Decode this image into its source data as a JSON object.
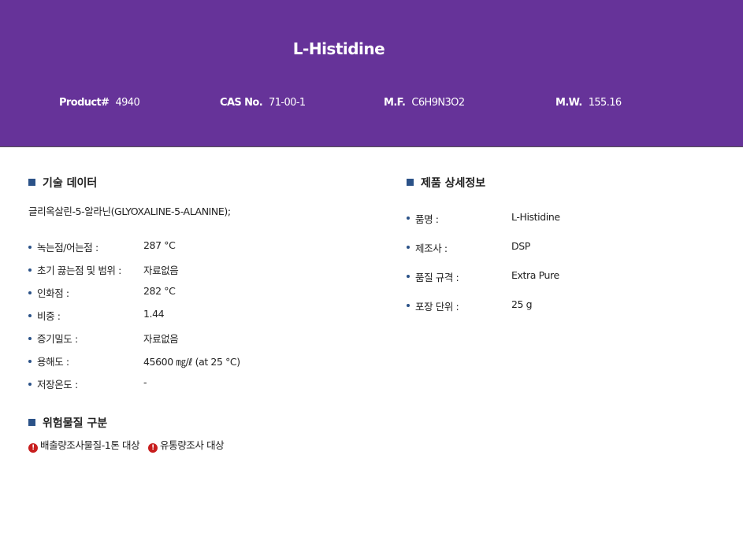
{
  "header": {
    "title": "L-Histidine",
    "product_label": "Product#",
    "product_value": "4940",
    "cas_label": "CAS No.",
    "cas_value": "71-00-1",
    "mf_label": "M.F.",
    "mf_value": "C6H9N3O2",
    "mw_label": "M.W.",
    "mw_value": "155.16",
    "background_color": "#663399"
  },
  "tech_data": {
    "heading": "기술 데이터",
    "synonym": "글리옥살린-5-알라닌(GLYOXALINE-5-ALANINE);",
    "properties": [
      {
        "label": "녹는점/어는점 :",
        "value": "287 °C"
      },
      {
        "label": "초기 끓는점 및 범위 :",
        "value": "자료없음"
      },
      {
        "label": "인화점 :",
        "value": "282 °C"
      },
      {
        "label": "비중 :",
        "value": "1.44"
      },
      {
        "label": "증기밀도 :",
        "value": "자료없음"
      },
      {
        "label": "용해도 :",
        "value": "45600 ㎎/ℓ (at 25 °C)"
      },
      {
        "label": "저장온도 :",
        "value": "-"
      }
    ]
  },
  "product_details": {
    "heading": "제품 상세정보",
    "items": [
      {
        "label": "품명 :",
        "value": "L-Histidine"
      },
      {
        "label": "제조사 :",
        "value": "DSP"
      },
      {
        "label": "품질 규격 :",
        "value": "Extra Pure"
      },
      {
        "label": "포장 단위 :",
        "value": "25 g"
      }
    ]
  },
  "hazard": {
    "heading": "위험물질 구분",
    "badges": [
      {
        "icon": "exclamation-circle-icon",
        "text": "배출량조사물질-1톤 대상"
      },
      {
        "icon": "exclamation-circle-icon",
        "text": "유통량조사 대상"
      }
    ],
    "icon_color": "#c81e1e"
  },
  "accent_color": "#2b5288"
}
